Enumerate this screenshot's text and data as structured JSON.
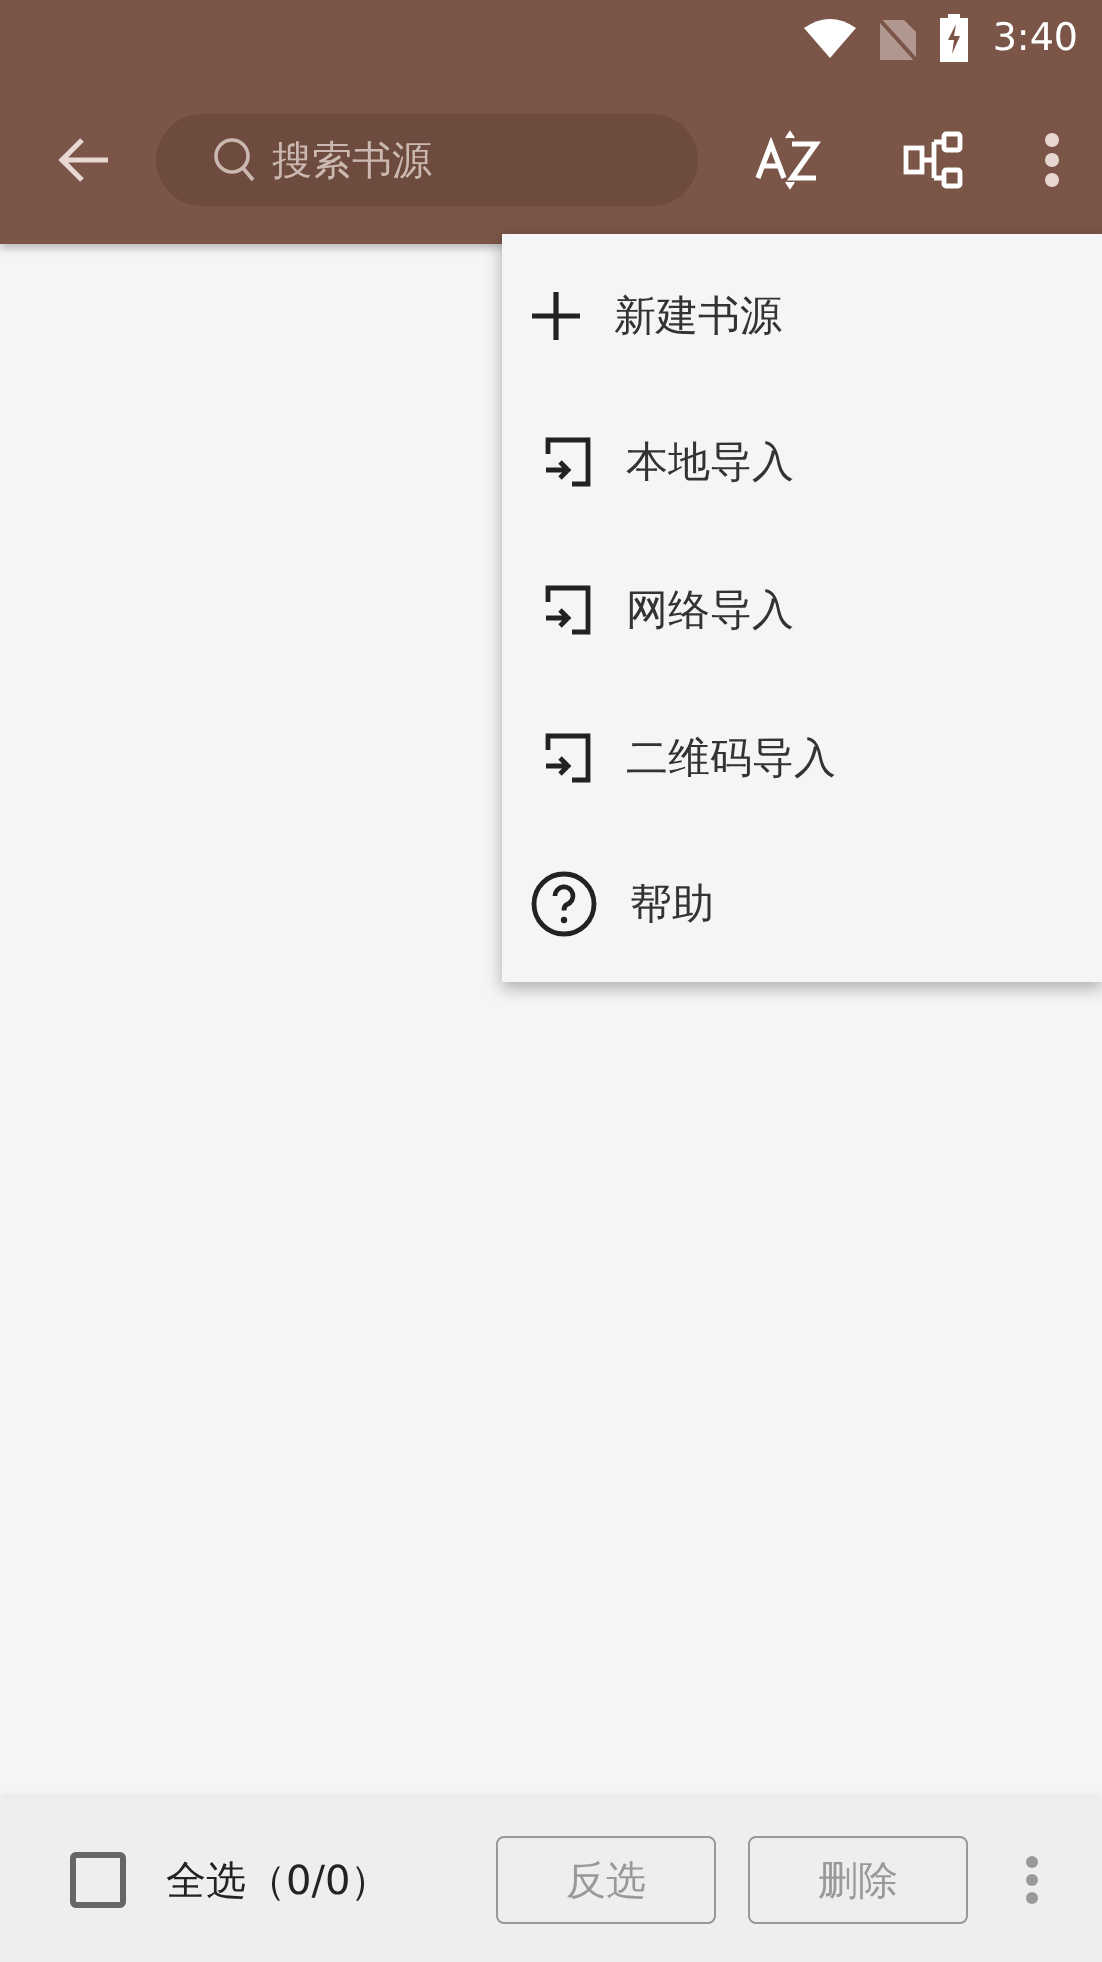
{
  "status_bar": {
    "time": "3:40"
  },
  "toolbar": {
    "search": {
      "placeholder": "搜索书源"
    }
  },
  "menu": [
    {
      "kind": "add",
      "label": "新建书源"
    },
    {
      "kind": "import",
      "label": "本地导入"
    },
    {
      "kind": "import",
      "label": "网络导入"
    },
    {
      "kind": "import",
      "label": "二维码导入"
    },
    {
      "kind": "help",
      "label": "帮助"
    }
  ],
  "bottom_bar": {
    "select_all": {
      "label": "全选（0/0）",
      "checked": false
    },
    "buttons": [
      "反选",
      "删除"
    ]
  }
}
